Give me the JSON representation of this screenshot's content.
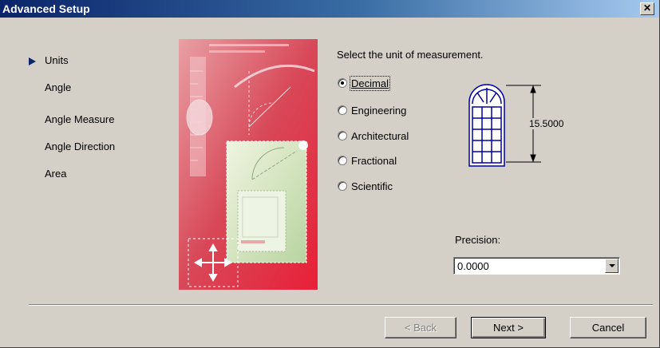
{
  "window": {
    "title": "Advanced Setup",
    "close_label": "✕"
  },
  "steps": [
    {
      "label": "Units",
      "current": true
    },
    {
      "label": "Angle",
      "current": false
    },
    {
      "label": "Angle Measure",
      "current": false
    },
    {
      "label": "Angle Direction",
      "current": false
    },
    {
      "label": "Area",
      "current": false
    }
  ],
  "units": {
    "prompt": "Select the unit of measurement.",
    "options": [
      {
        "label": "Decimal",
        "selected": true
      },
      {
        "label": "Engineering",
        "selected": false
      },
      {
        "label": "Architectural",
        "selected": false
      },
      {
        "label": "Fractional",
        "selected": false
      },
      {
        "label": "Scientific",
        "selected": false
      }
    ],
    "preview_dimension": "15.5000"
  },
  "precision": {
    "label": "Precision:",
    "value": "0.0000"
  },
  "buttons": {
    "back": "< Back",
    "next": "Next >",
    "cancel": "Cancel"
  },
  "colors": {
    "title_start": "#0a246a",
    "title_end": "#a6caf0",
    "dialog_face": "#d4d0c8",
    "preview_blue": "#0000a8",
    "illustration_red": "#e04050"
  }
}
